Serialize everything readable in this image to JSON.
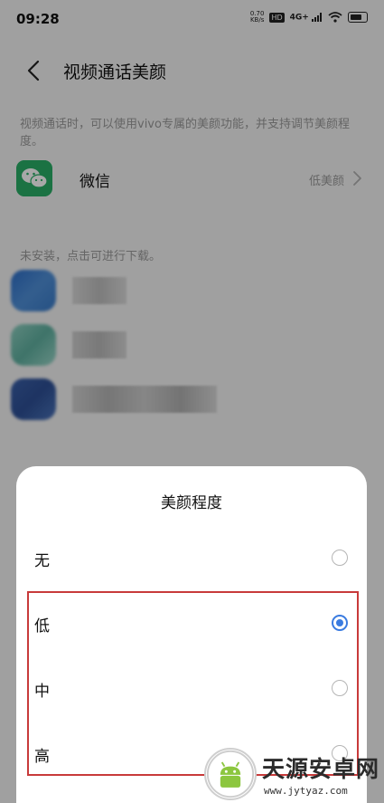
{
  "status_bar": {
    "time": "09:28",
    "net_speed_value": "0.70",
    "net_speed_unit": "KB/s",
    "hd_badge": "HD",
    "signal_label": "4G+",
    "icons": [
      "hd-icon",
      "signal-icon",
      "wifi-icon",
      "battery-icon"
    ]
  },
  "header": {
    "title": "视频通话美颜",
    "back_icon": "chevron-left-icon"
  },
  "description": "视频通话时，可以使用vivo专属的美颜功能，并支持调节美颜程度。",
  "installed_apps": [
    {
      "name": "微信",
      "value": "低美颜",
      "icon": "wechat-icon"
    }
  ],
  "not_installed_hint": "未安装，点击可进行下载。",
  "sheet": {
    "title": "美颜程度",
    "options": [
      {
        "label": "无",
        "selected": false
      },
      {
        "label": "低",
        "selected": true
      },
      {
        "label": "中",
        "selected": false
      },
      {
        "label": "高",
        "selected": false
      }
    ]
  },
  "colors": {
    "accent": "#3a7be0",
    "wechat_green": "#2aae67",
    "highlight_red": "#c83a3a"
  },
  "watermark": {
    "title": "天源安卓网",
    "url": "www.jytyaz.com"
  }
}
